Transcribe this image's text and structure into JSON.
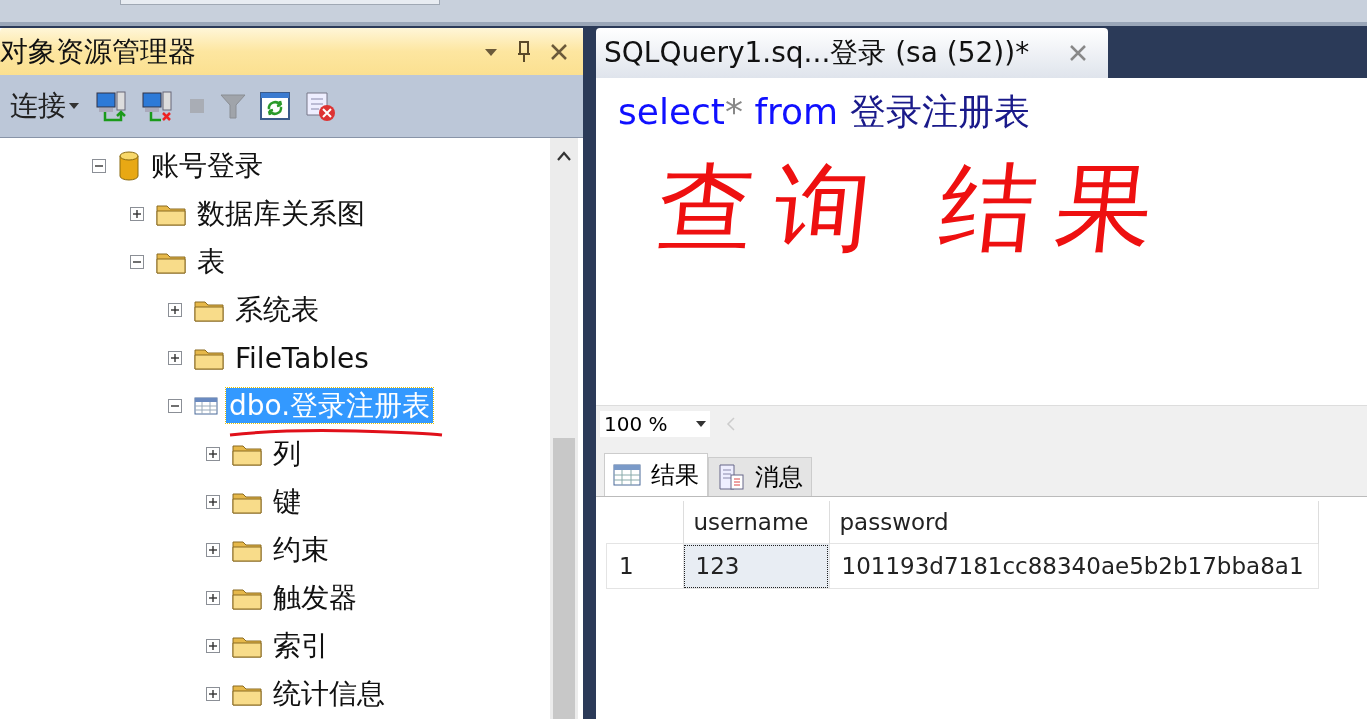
{
  "object_explorer": {
    "title": "对象资源管理器",
    "toolbar": {
      "connect_label": "连接"
    },
    "tree": [
      {
        "label": "账号登录",
        "kind": "database",
        "expanded": true,
        "selected": false,
        "children": [
          {
            "label": "数据库关系图",
            "kind": "folder",
            "expanded": false,
            "selected": false
          },
          {
            "label": "表",
            "kind": "folder",
            "expanded": true,
            "selected": false,
            "children": [
              {
                "label": "系统表",
                "kind": "folder",
                "expanded": false,
                "selected": false
              },
              {
                "label": "FileTables",
                "kind": "folder",
                "expanded": false,
                "selected": false
              },
              {
                "label": "dbo.登录注册表",
                "kind": "table",
                "expanded": true,
                "selected": true,
                "underlined": true,
                "children": [
                  {
                    "label": "列",
                    "kind": "folder",
                    "expanded": false,
                    "selected": false
                  },
                  {
                    "label": "键",
                    "kind": "folder",
                    "expanded": false,
                    "selected": false
                  },
                  {
                    "label": "约束",
                    "kind": "folder",
                    "expanded": false,
                    "selected": false
                  },
                  {
                    "label": "触发器",
                    "kind": "folder",
                    "expanded": false,
                    "selected": false
                  },
                  {
                    "label": "索引",
                    "kind": "folder",
                    "expanded": false,
                    "selected": false
                  },
                  {
                    "label": "统计信息",
                    "kind": "folder",
                    "expanded": false,
                    "selected": false
                  }
                ]
              }
            ]
          }
        ]
      }
    ]
  },
  "query_tab": {
    "title": "SQLQuery1.sq...登录 (sa (52))*"
  },
  "editor": {
    "code": [
      {
        "kind": "keyword",
        "text": "select"
      },
      {
        "kind": "operator",
        "text": "*"
      },
      {
        "kind": "keyword",
        "text": " from"
      },
      {
        "kind": "name",
        "text": " 登录注册表"
      }
    ],
    "annotation": "查询 结果"
  },
  "zoom": "100 %",
  "result_tabs": [
    {
      "label": "结果",
      "kind": "grid",
      "selected": true
    },
    {
      "label": "消息",
      "kind": "messages",
      "selected": false
    }
  ],
  "results": {
    "columns": [
      "username",
      "password"
    ],
    "rows": [
      {
        "number": "1",
        "cells": [
          {
            "text": "123",
            "selected": true
          },
          {
            "text": "101193d7181cc88340ae5b2b17bba8a1",
            "selected": false
          }
        ]
      }
    ]
  }
}
